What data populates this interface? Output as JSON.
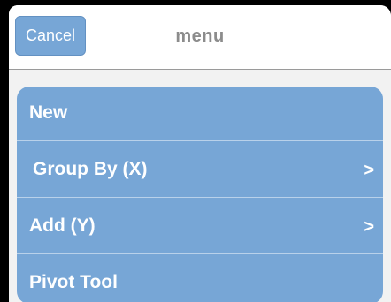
{
  "navbar": {
    "cancel_label": "Cancel",
    "title": "menu"
  },
  "menu": {
    "items": [
      {
        "label": "New",
        "chevron": ""
      },
      {
        "label": "Group By (X)",
        "chevron": ">"
      },
      {
        "label": "Add (Y)",
        "chevron": ">"
      },
      {
        "label": "Pivot Tool",
        "chevron": ""
      }
    ]
  },
  "colors": {
    "accent": "#77a6d6",
    "title_text": "#8c8c8c",
    "frame": "#000000"
  }
}
